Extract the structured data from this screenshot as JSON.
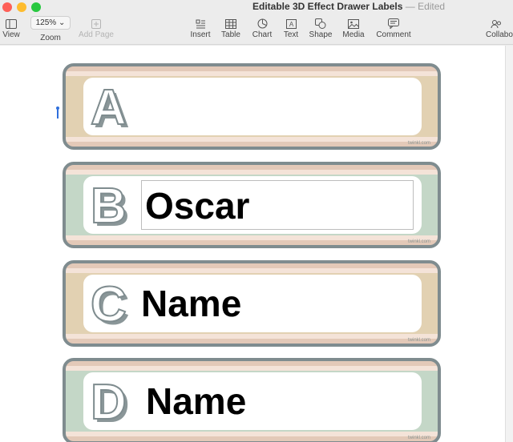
{
  "window": {
    "title": "Editable 3D Effect Drawer Labels",
    "status": "— Edited"
  },
  "toolbar": {
    "view": "View",
    "zoom_value": "125%",
    "zoom": "Zoom",
    "add_page": "Add Page",
    "insert": "Insert",
    "table": "Table",
    "chart": "Chart",
    "text": "Text",
    "shape": "Shape",
    "media": "Media",
    "comment": "Comment",
    "collaborate": "Collabo"
  },
  "labels": [
    {
      "letter": "A",
      "name": "",
      "watermark": "twinkl.com"
    },
    {
      "letter": "B",
      "name": "Oscar",
      "watermark": "twinkl.com"
    },
    {
      "letter": "C",
      "name": "Name",
      "watermark": "twinkl.com"
    },
    {
      "letter": "D",
      "name": "Name",
      "watermark": "twinkl.com"
    }
  ],
  "colors": {
    "frame": "#7f8c8f",
    "band_tan": "#e2d1b2",
    "band_green": "#c4d7c7",
    "letter_shadow": "#8a9698",
    "caret": "#2f6fdc"
  }
}
